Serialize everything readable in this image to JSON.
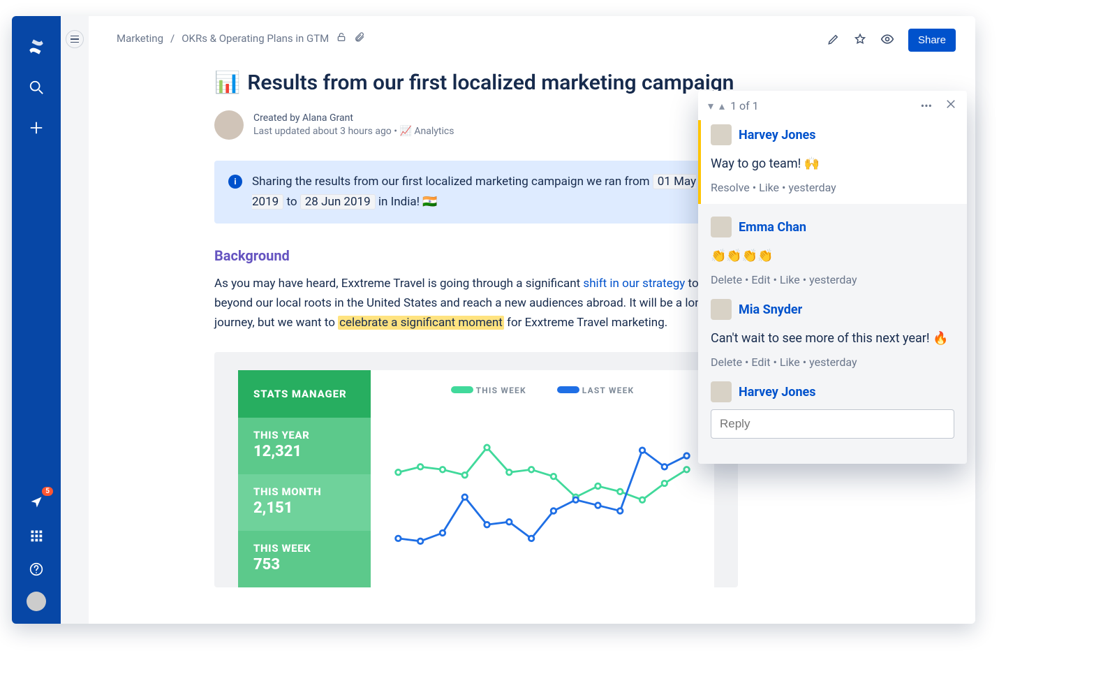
{
  "rail": {
    "notif_count": "5"
  },
  "breadcrumb": {
    "space": "Marketing",
    "page": "OKRs & Operating Plans in GTM"
  },
  "actions": {
    "share": "Share"
  },
  "article": {
    "title_emoji": "📊",
    "title": "Results from our first localized marketing campaign",
    "created_by": "Created by Alana Grant",
    "updated": "Last updated about 3 hours ago",
    "analytics": "Analytics",
    "info_prefix": "Sharing the results from our first localized marketing campaign we ran from",
    "info_date1": "01 May 2019",
    "info_mid": "to",
    "info_date2": "28 Jun 2019",
    "info_suffix": "in India! 🇮🇳",
    "bg_heading": "Background",
    "body_pre": "As you may have heard, Exxtreme Travel is going through a significant ",
    "body_link": "shift in our strategy",
    "body_mid": " to extend beyond our local roots in the United States and reach a new audiences abroad. It will be a long journey, but we want to ",
    "body_hl": "celebrate a significant moment",
    "body_post": " for Exxtreme Travel marketing."
  },
  "chart": {
    "header": "STATS MANAGER",
    "legend_this": "THIS WEEK",
    "legend_last": "LAST WEEK",
    "stat1_lbl": "THIS YEAR",
    "stat1_val": "12,321",
    "stat2_lbl": "THIS MONTH",
    "stat2_val": "2,151",
    "stat3_lbl": "THIS WEEK",
    "stat3_val": "753"
  },
  "chart_data": {
    "type": "line",
    "x": [
      1,
      2,
      3,
      4,
      5,
      6,
      7,
      8,
      9,
      10,
      11,
      12,
      13,
      14
    ],
    "series": [
      {
        "name": "THIS WEEK",
        "color": "#41D99B",
        "values": [
          58,
          62,
          60,
          56,
          76,
          58,
          60,
          55,
          40,
          48,
          44,
          38,
          50,
          60
        ]
      },
      {
        "name": "LAST WEEK",
        "color": "#1F6FE5",
        "values": [
          10,
          8,
          14,
          40,
          20,
          22,
          10,
          30,
          38,
          34,
          30,
          74,
          62,
          70
        ]
      }
    ],
    "ylim": [
      0,
      100
    ]
  },
  "comments": {
    "counter": "1 of 1",
    "c1": {
      "name": "Harvey Jones",
      "body": "Way to go team! 🙌",
      "actions": "Resolve • Like • yesterday"
    },
    "r1": {
      "name": "Emma Chan",
      "body": "👏👏👏👏",
      "actions": "Delete • Edit • Like • yesterday"
    },
    "r2": {
      "name": "Mia Snyder",
      "body": "Can't wait to see more of this next year! 🔥",
      "actions": "Delete • Edit • Like • yesterday"
    },
    "reply_user": "Harvey Jones",
    "reply_placeholder": "Reply"
  }
}
